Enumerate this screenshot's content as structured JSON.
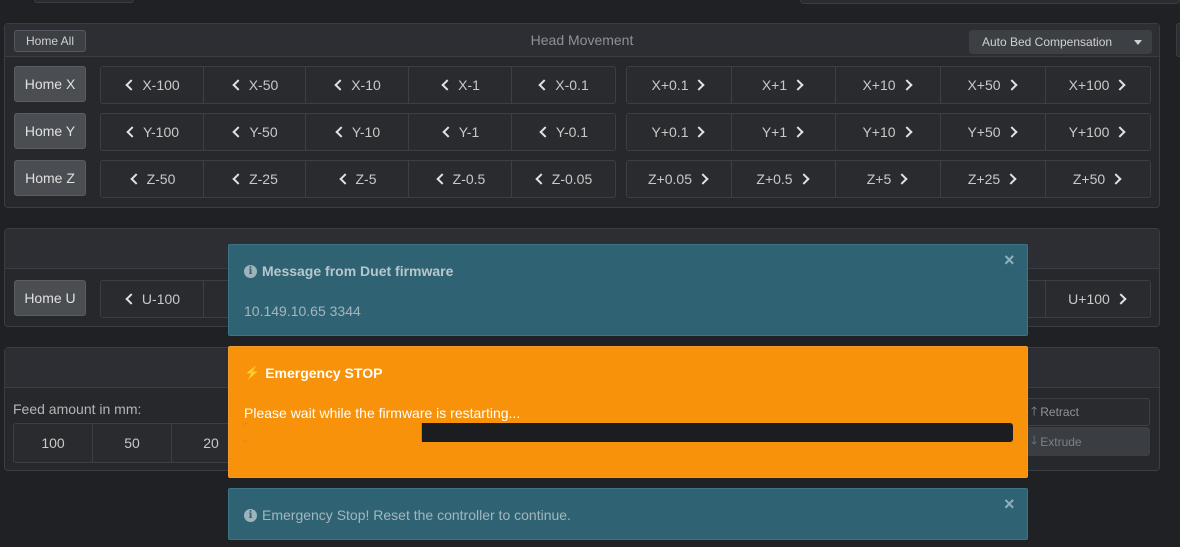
{
  "head_movement": {
    "home_all_label": "Home All",
    "title": "Head Movement",
    "auto_bed_label": "Auto Bed Compensation",
    "rows": [
      {
        "home_label": "Home X",
        "minus": [
          "X-100",
          "X-50",
          "X-10",
          "X-1",
          "X-0.1"
        ],
        "plus": [
          "X+0.1",
          "X+1",
          "X+10",
          "X+50",
          "X+100"
        ]
      },
      {
        "home_label": "Home Y",
        "minus": [
          "Y-100",
          "Y-50",
          "Y-10",
          "Y-1",
          "Y-0.1"
        ],
        "plus": [
          "Y+0.1",
          "Y+1",
          "Y+10",
          "Y+50",
          "Y+100"
        ]
      },
      {
        "home_label": "Home Z",
        "minus": [
          "Z-50",
          "Z-25",
          "Z-5",
          "Z-0.5",
          "Z-0.05"
        ],
        "plus": [
          "Z+0.05",
          "Z+0.5",
          "Z+5",
          "Z+25",
          "Z+50"
        ]
      }
    ]
  },
  "u_axis": {
    "home_label": "Home U",
    "minus_first": "U-100",
    "plus_last": "U+100"
  },
  "extruder": {
    "feed_label": "Feed amount in mm:",
    "amounts": [
      "100",
      "50",
      "20"
    ],
    "retract_label": "Retract",
    "extrude_label": "Extrude"
  },
  "notifications": {
    "message": {
      "title": "Message from Duet firmware",
      "body": "10.149.10.65 3344",
      "close": "×"
    },
    "emergency": {
      "title": "Emergency STOP",
      "body": "Please wait while the firmware is restarting...",
      "progress": 0.23
    },
    "info": {
      "body": "Emergency Stop! Reset the controller to continue.",
      "close": "×"
    }
  },
  "colors": {
    "info_bg": "#2f6373",
    "warning_bg": "#f7920a",
    "progress_track": "#1c1d21"
  }
}
